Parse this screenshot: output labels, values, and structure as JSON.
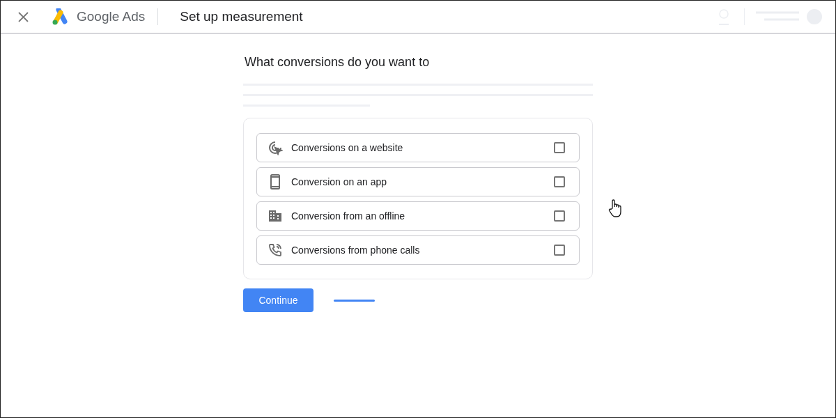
{
  "header": {
    "brand": "Google Ads",
    "title": "Set up measurement"
  },
  "question": "What conversions do you want to",
  "options": [
    {
      "kind": "website",
      "label": "Conversions on a website",
      "checked": false
    },
    {
      "kind": "app",
      "label": "Conversion on an app",
      "checked": false
    },
    {
      "kind": "offline",
      "label": "Conversion from an offline",
      "checked": false
    },
    {
      "kind": "calls",
      "label": "Conversions from phone calls",
      "checked": false
    }
  ],
  "continue_button": "Continue"
}
